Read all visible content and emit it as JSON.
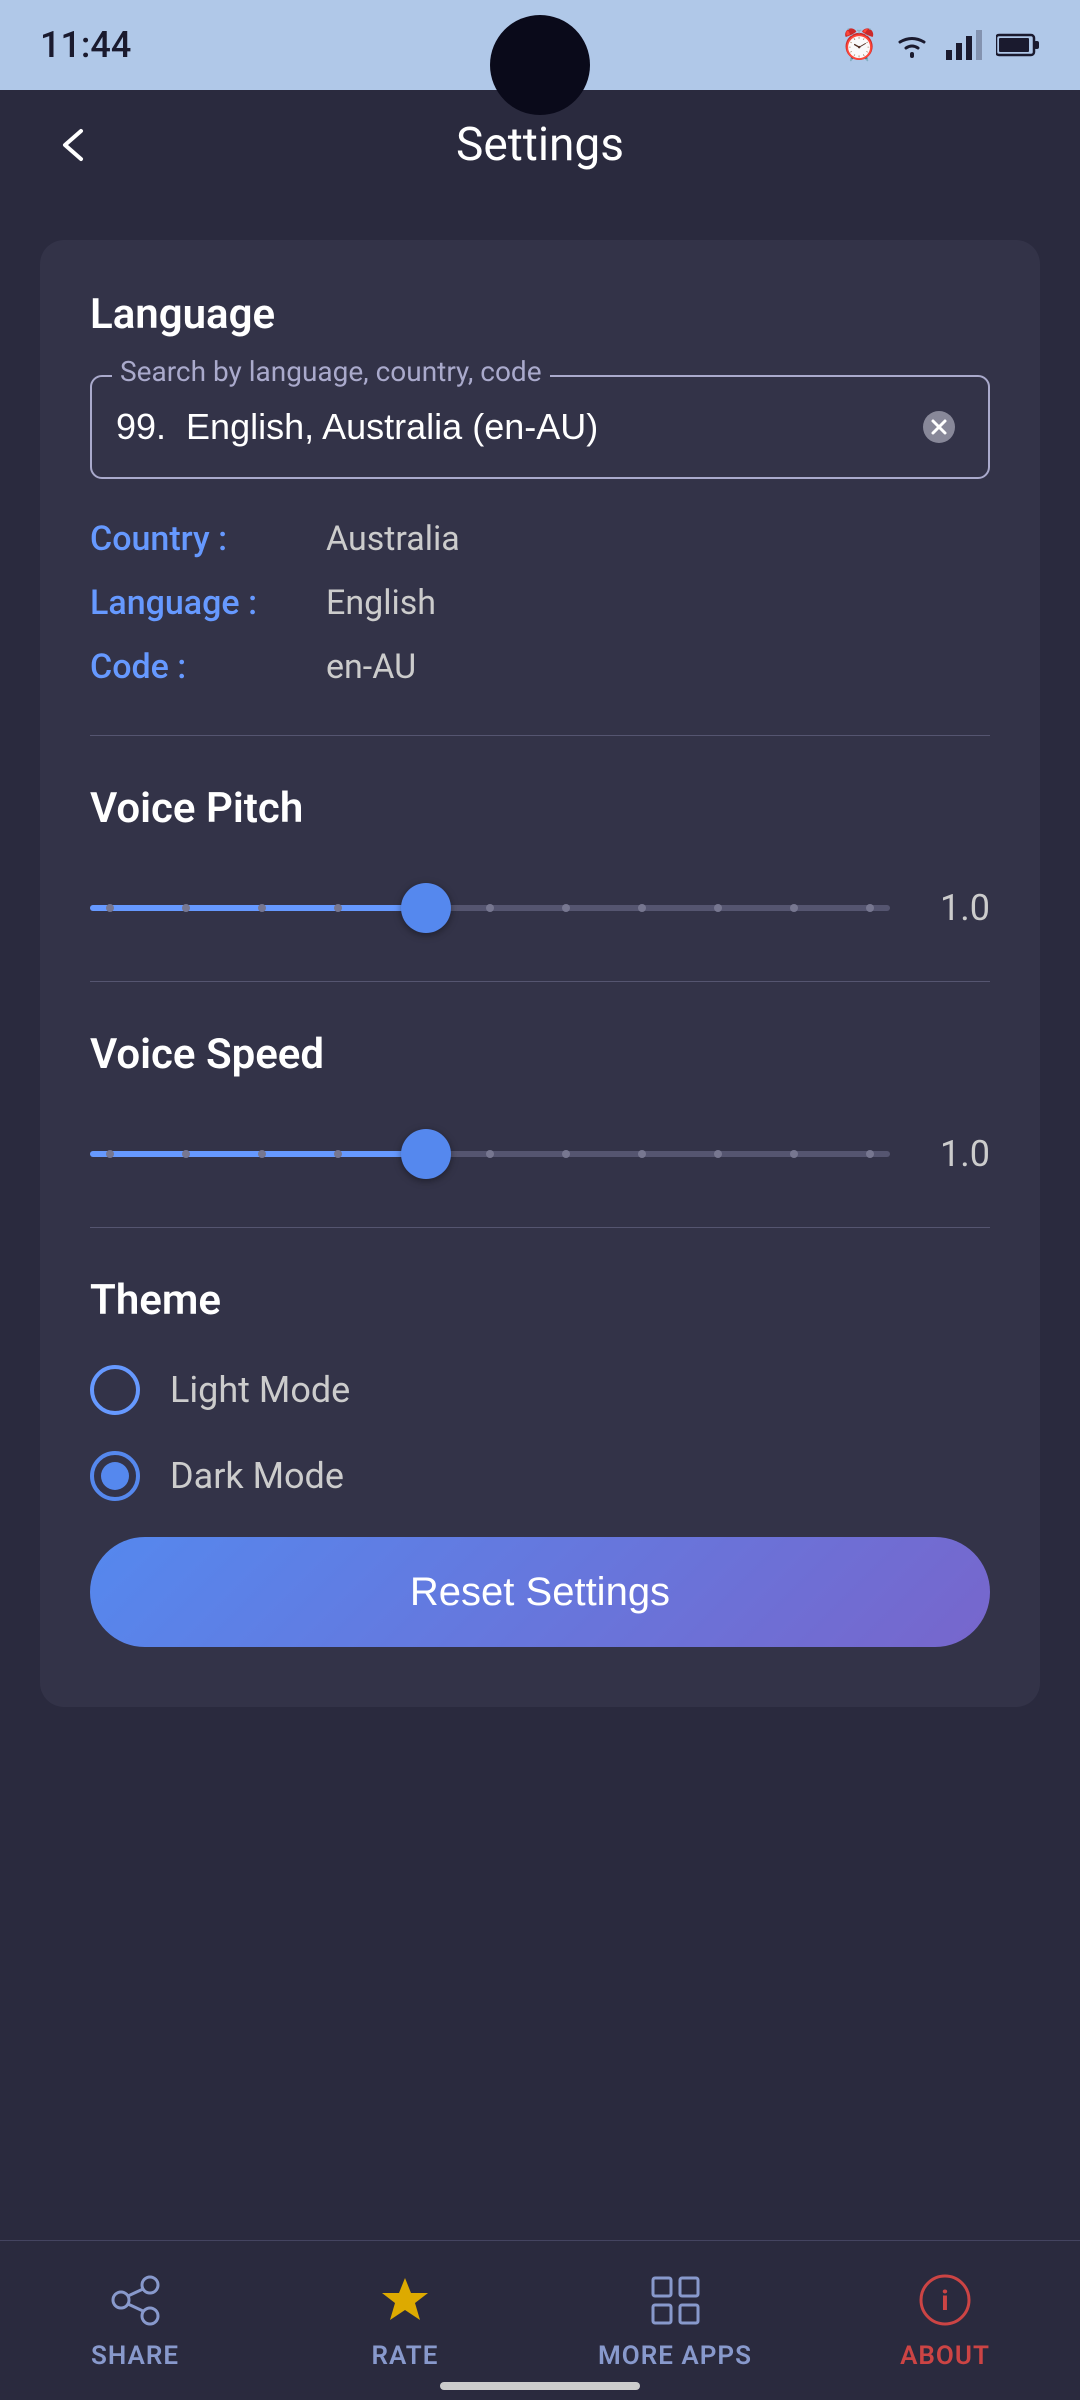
{
  "statusBar": {
    "time": "11:44",
    "icons": [
      "alarm",
      "wifi",
      "signal",
      "battery"
    ]
  },
  "appBar": {
    "title": "Settings",
    "backLabel": "back"
  },
  "language": {
    "sectionTitle": "Language",
    "searchPlaceholder": "Search by language, country, code",
    "searchValue": "99.  English, Australia (en-AU)",
    "countryLabel": "Country :",
    "countryValue": "Australia",
    "languageLabel": "Language :",
    "languageValue": "English",
    "codeLabel": "Code :",
    "codeValue": "en-AU"
  },
  "voicePitch": {
    "sectionTitle": "Voice Pitch",
    "value": "1.0",
    "sliderPercent": 42
  },
  "voiceSpeed": {
    "sectionTitle": "Voice Speed",
    "value": "1.0",
    "sliderPercent": 42
  },
  "theme": {
    "sectionTitle": "Theme",
    "options": [
      {
        "label": "Light Mode",
        "selected": false
      },
      {
        "label": "Dark Mode",
        "selected": true
      }
    ]
  },
  "resetButton": {
    "label": "Reset Settings"
  },
  "bottomNav": {
    "items": [
      {
        "id": "share",
        "label": "SHARE",
        "icon": "share"
      },
      {
        "id": "rate",
        "label": "RATE",
        "icon": "star"
      },
      {
        "id": "more",
        "label": "MORE APPS",
        "icon": "grid"
      },
      {
        "id": "about",
        "label": "ABOUT",
        "icon": "info"
      }
    ]
  }
}
